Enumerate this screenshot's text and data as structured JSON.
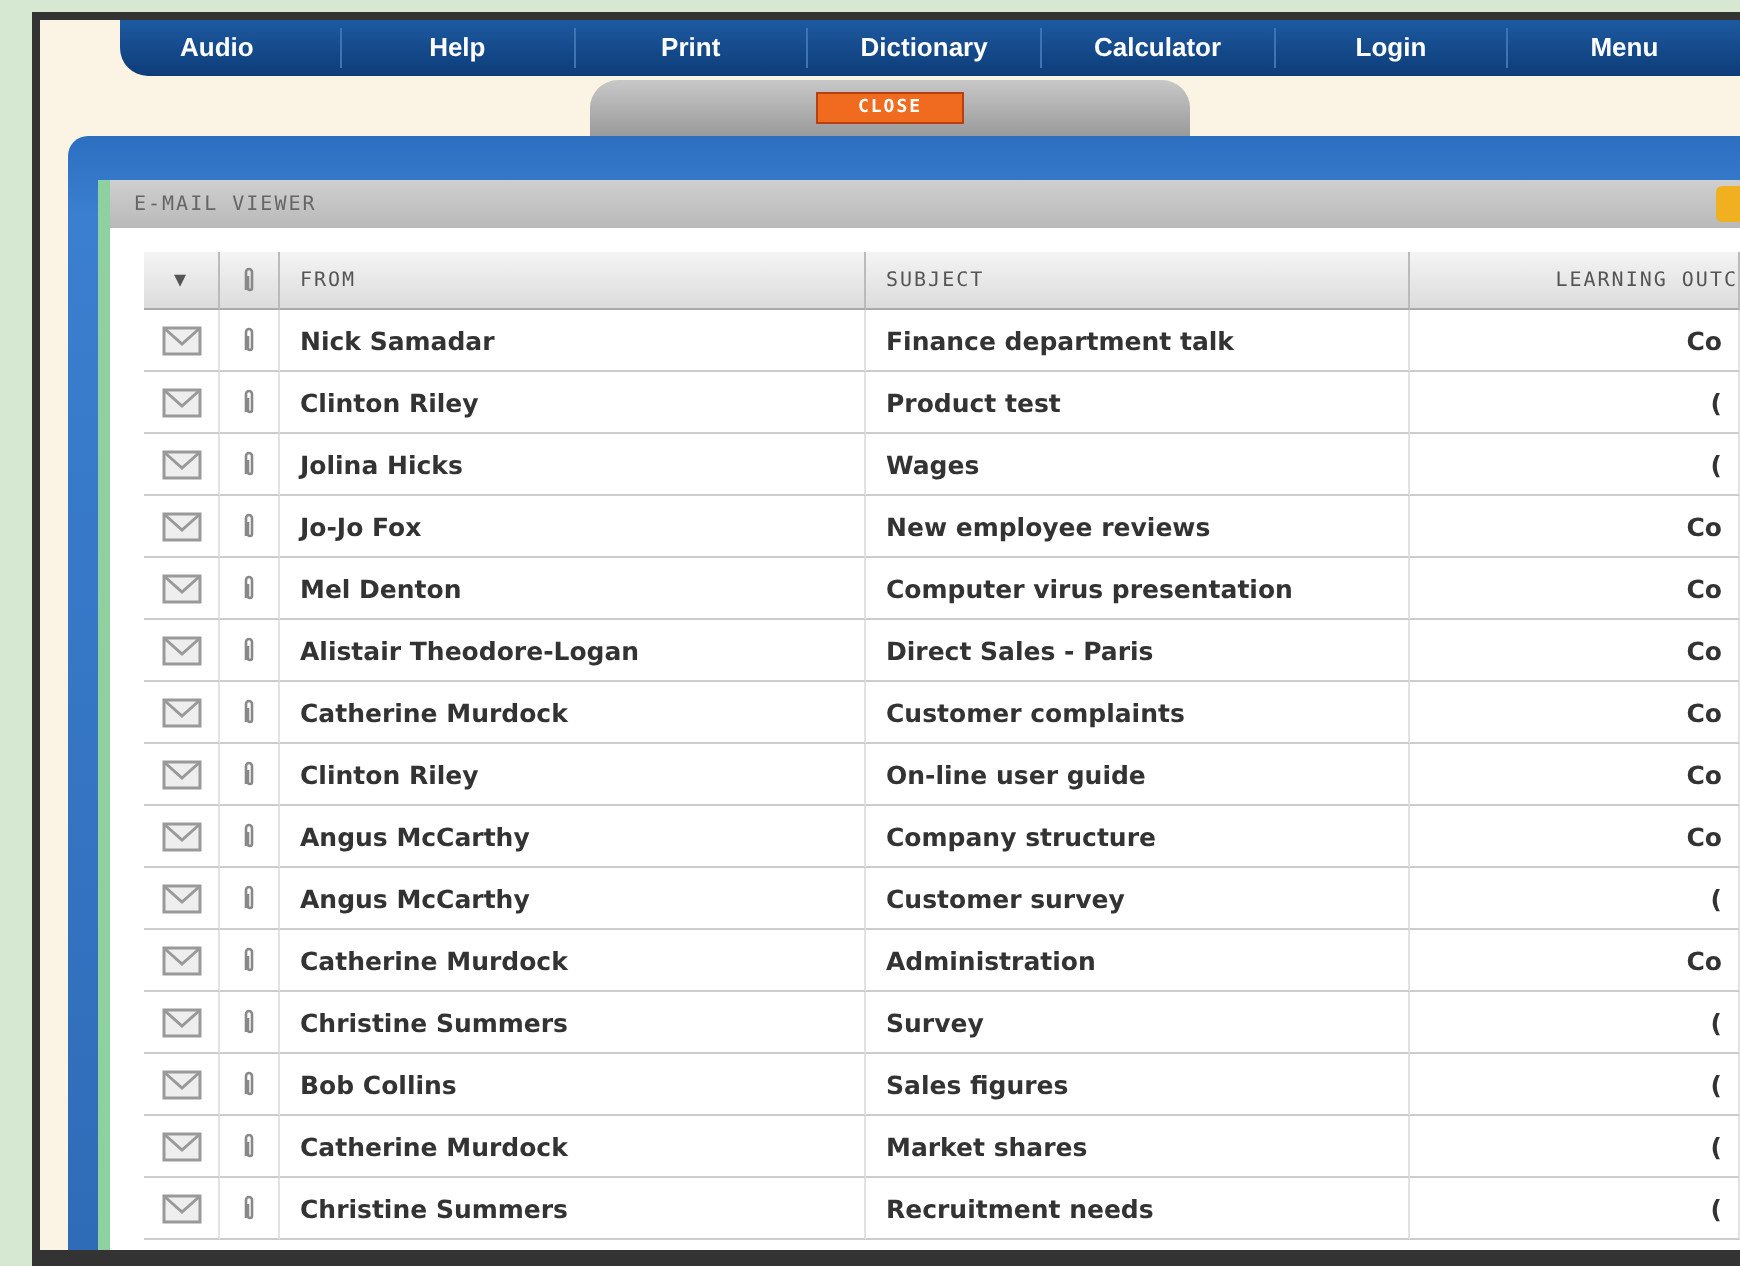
{
  "nav": [
    "Audio",
    "Help",
    "Print",
    "Dictionary",
    "Calculator",
    "Login",
    "Menu"
  ],
  "close_button": "CLOSE",
  "viewer": {
    "title": "E-MAIL VIEWER",
    "table": {
      "columns": [
        "▼",
        "FROM",
        "SUBJECT",
        "LEARNING OUTC"
      ],
      "rows": [
        {
          "from": "Nick Samadar",
          "subject": "Finance department talk",
          "outcome": "Co"
        },
        {
          "from": "Clinton Riley",
          "subject": "Product test",
          "outcome": "("
        },
        {
          "from": "Jolina Hicks",
          "subject": "Wages",
          "outcome": "("
        },
        {
          "from": "Jo-Jo Fox",
          "subject": "New employee reviews",
          "outcome": "Co"
        },
        {
          "from": "Mel Denton",
          "subject": "Computer virus presentation",
          "outcome": "Co"
        },
        {
          "from": "Alistair Theodore-Logan",
          "subject": "Direct Sales - Paris",
          "outcome": "Co"
        },
        {
          "from": "Catherine Murdock",
          "subject": "Customer complaints",
          "outcome": "Co"
        },
        {
          "from": "Clinton Riley",
          "subject": "On-line user guide",
          "outcome": "Co"
        },
        {
          "from": "Angus McCarthy",
          "subject": "Company structure",
          "outcome": "Co"
        },
        {
          "from": "Angus McCarthy",
          "subject": "Customer survey",
          "outcome": "("
        },
        {
          "from": "Catherine Murdock",
          "subject": "Administration",
          "outcome": "Co"
        },
        {
          "from": "Christine Summers",
          "subject": "Survey",
          "outcome": "("
        },
        {
          "from": "Bob Collins",
          "subject": "Sales figures",
          "outcome": "("
        },
        {
          "from": "Catherine Murdock",
          "subject": "Market shares",
          "outcome": "("
        },
        {
          "from": "Christine Summers",
          "subject": "Recruitment needs",
          "outcome": "("
        }
      ]
    }
  }
}
